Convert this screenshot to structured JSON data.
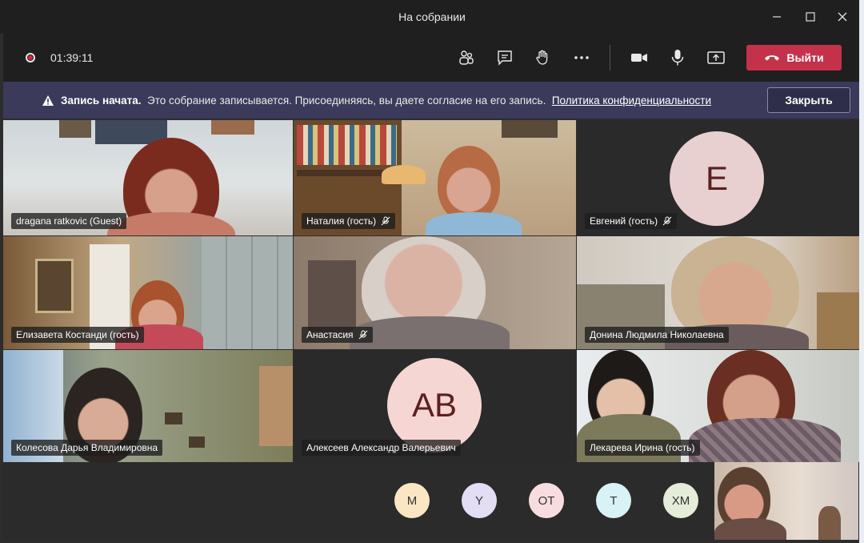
{
  "window": {
    "title": "На собрании"
  },
  "toolbar": {
    "timer": "01:39:11",
    "leave_label": "Выйти"
  },
  "banner": {
    "title": "Запись начата.",
    "message": "Это собрание записывается. Присоединяясь, вы даете согласие на его запись.",
    "link": "Политика конфиденциальности",
    "close_label": "Закрыть"
  },
  "participants": [
    {
      "name": "dragana ratkovic (Guest)",
      "muted": false
    },
    {
      "name": "Наталия (гость)",
      "muted": true
    },
    {
      "name": "Евгений (гость)",
      "muted": true,
      "initials": "E"
    },
    {
      "name": "Елизавета Костанди (гость)",
      "muted": false
    },
    {
      "name": "Анастасия",
      "muted": true
    },
    {
      "name": "Донина Людмила Николаевна",
      "muted": false
    },
    {
      "name": "Колесова Дарья Владимировна",
      "muted": false
    },
    {
      "name": "Алексеев Александр Валерьевич",
      "muted": false,
      "initials": "AB"
    },
    {
      "name": "Лекарева Ирина (гость)",
      "muted": false
    }
  ],
  "overflow_avatars": [
    {
      "initials": "M",
      "color": "#fbe6c4"
    },
    {
      "initials": "Y",
      "color": "#e3def4"
    },
    {
      "initials": "OT",
      "color": "#f8dde0"
    },
    {
      "initials": "T",
      "color": "#d9f2f5"
    },
    {
      "initials": "XM",
      "color": "#e5ecd8"
    }
  ],
  "colors": {
    "leave": "#c4314b",
    "banner": "#3b3a5b",
    "avatar_e": "#e8cfd0",
    "avatar_ab": "#f6d6d3"
  }
}
